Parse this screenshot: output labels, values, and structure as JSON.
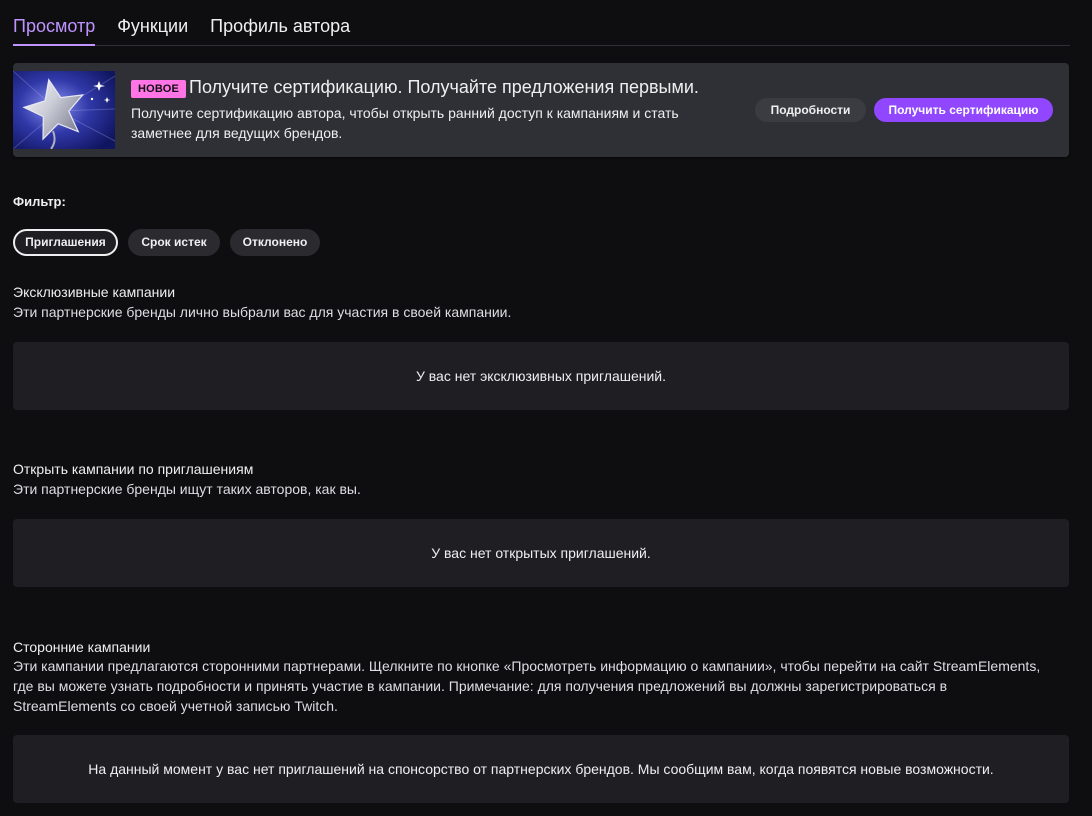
{
  "tabs": [
    {
      "label": "Просмотр",
      "active": true
    },
    {
      "label": "Функции",
      "active": false
    },
    {
      "label": "Профиль автора",
      "active": false
    }
  ],
  "banner": {
    "badge": "НОВОЕ",
    "title": "Получите сертификацию. Получайте предложения первыми.",
    "description": "Получите сертификацию автора, чтобы открыть ранний доступ к кампаниям и стать заметнее для ведущих брендов.",
    "details_label": "Подробности",
    "certify_label": "Получить сертификацию"
  },
  "filter": {
    "label": "Фильтр:",
    "options": [
      "Приглашения",
      "Срок истек",
      "Отклонено"
    ],
    "selected": "Приглашения"
  },
  "sections": [
    {
      "title": "Эксклюзивные кампании",
      "description": "Эти партнерские бренды лично выбрали вас для участия в своей кампании.",
      "empty_text": "У вас нет эксклюзивных приглашений."
    },
    {
      "title": "Открыть кампании по приглашениям",
      "description": "Эти партнерские бренды ищут таких авторов, как вы.",
      "empty_text": "У вас нет открытых приглашений."
    },
    {
      "title": "Сторонние кампании",
      "description": "Эти кампании предлагаются сторонними партнерами. Щелкните по кнопке «Просмотреть информацию о кампании», чтобы перейти на сайт StreamElements, где вы можете узнать подробности и принять участие в кампании. Примечание: для получения предложений вы должны зарегистрироваться в StreamElements со своей учетной записью Twitch.",
      "empty_text": "На данный момент у вас нет приглашений на спонсорство от партнерских брендов. Мы сообщим вам, когда появятся новые возможности."
    }
  ],
  "colors": {
    "accent": "#bf94ff",
    "primary_button": "#9147ff",
    "badge": "#ff75e6",
    "background": "#0e0e10"
  }
}
